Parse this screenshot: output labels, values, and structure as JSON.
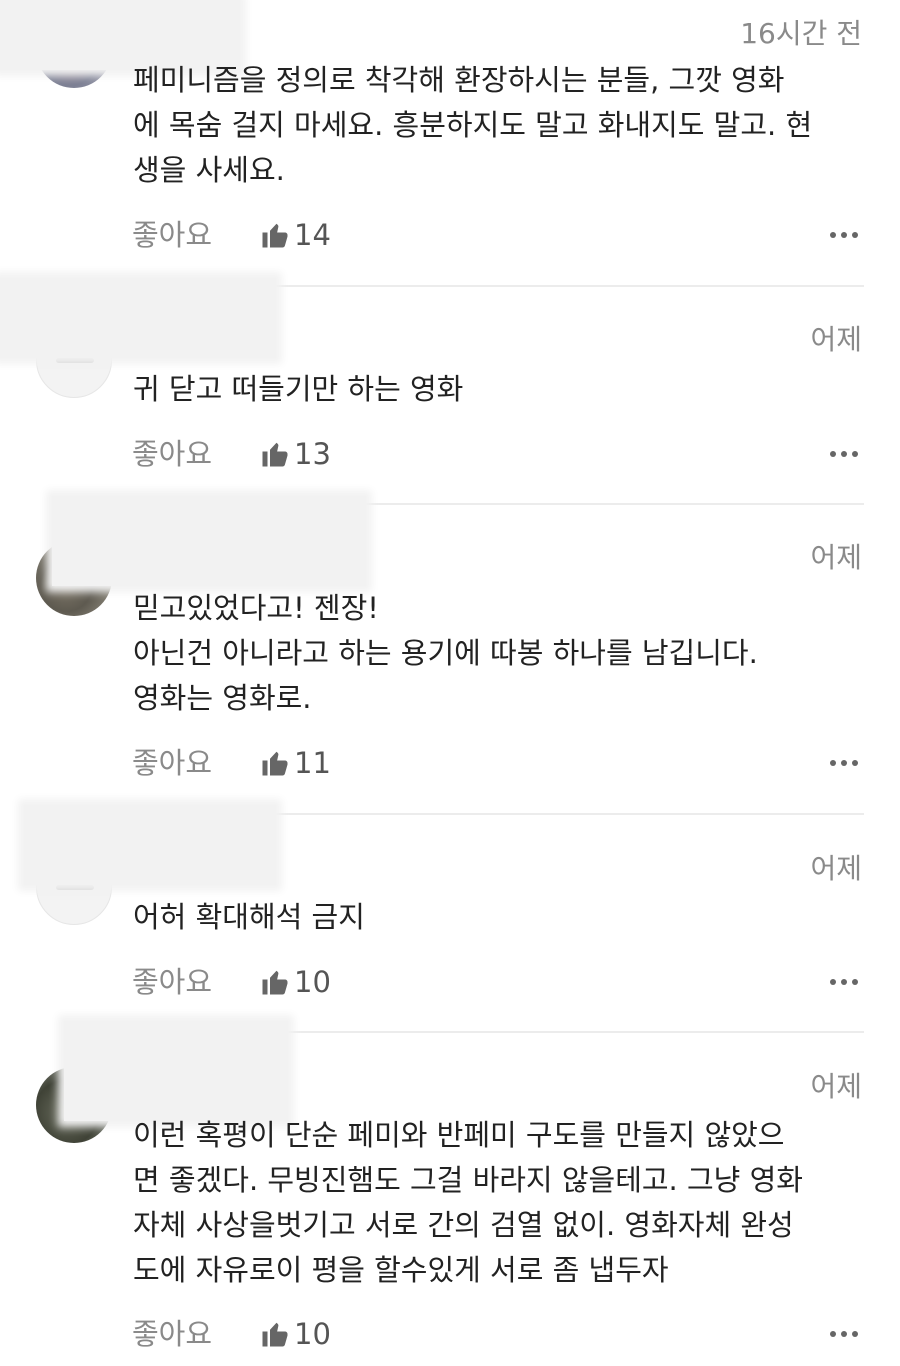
{
  "comments": [
    {
      "time": "16시간 전",
      "lines": [
        "페미니즘을 정의로 착각해 환장하시는 분들, 그깟 영화",
        "에 목숨 걸지 마세요. 흥분하지도 말고 화내지도 말고. 현",
        "생을 사세요."
      ],
      "like_label": "좋아요",
      "likes": "14"
    },
    {
      "time": "어제",
      "lines": [
        "귀 닫고 떠들기만 하는 영화"
      ],
      "like_label": "좋아요",
      "likes": "13"
    },
    {
      "time": "어제",
      "lines": [
        "믿고있었다고! 젠장!",
        "아닌건 아니라고 하는 용기에 따봉 하나를 남깁니다.",
        "영화는 영화로."
      ],
      "like_label": "좋아요",
      "likes": "11"
    },
    {
      "time": "어제",
      "lines": [
        "어허 확대해석 금지"
      ],
      "like_label": "좋아요",
      "likes": "10"
    },
    {
      "time": "어제",
      "lines": [
        "이런 혹평이 단순 페미와 반페미 구도를 만들지 않았으",
        "면 좋겠다. 무빙진햄도 그걸 바라지 않을테고. 그냥 영화",
        "자체 사상을벗기고 서로 간의 검열 없이. 영화자체 완성",
        "도에 자유로이  평을 할수있게 서로 좀 냅두자"
      ],
      "like_label": "좋아요",
      "likes": "10"
    }
  ],
  "icons": {
    "like": "thumbs-up-icon",
    "more": "more-horizontal-icon",
    "avatar_default": "default-avatar-icon"
  },
  "colors": {
    "muted_text": "#8a8a8a",
    "body_text": "#222222",
    "divider": "#ececec"
  }
}
